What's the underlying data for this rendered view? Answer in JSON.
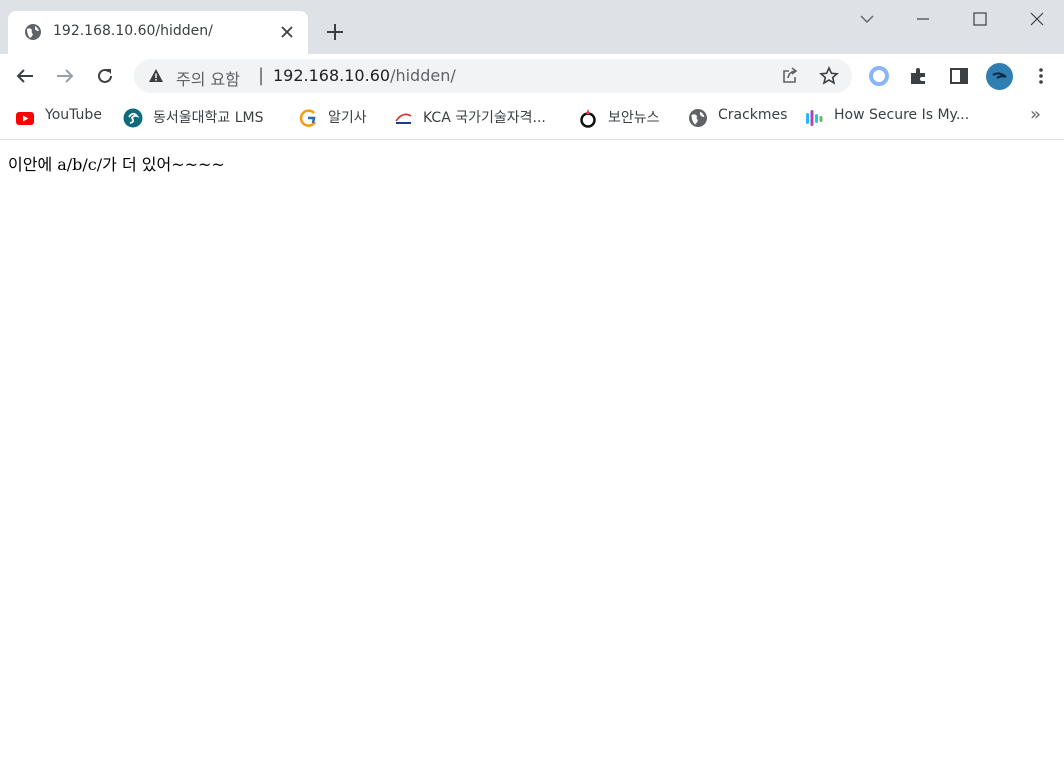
{
  "tab": {
    "title": "192.168.10.60/hidden/"
  },
  "omnibox": {
    "security_text": "주의 요함",
    "separator": "|",
    "url_host": "192.168.10.60",
    "url_path": "/hidden/"
  },
  "bookmarks": [
    {
      "label": "YouTube",
      "icon": "youtube-icon"
    },
    {
      "label": "동서울대학교 LMS",
      "icon": "dsu-icon"
    },
    {
      "label": "알기사",
      "icon": "algisa-icon"
    },
    {
      "label": "KCA 국가기술자격...",
      "icon": "kca-icon"
    },
    {
      "label": "보안뉴스",
      "icon": "boannews-icon"
    },
    {
      "label": "Crackmes",
      "icon": "globe-icon"
    },
    {
      "label": "How Secure Is My...",
      "icon": "hsim-icon"
    }
  ],
  "bookmarks_more": "»",
  "page": {
    "text": "이안에 a/b/c/가 더 있어~~~~"
  },
  "colors": {
    "titlebar": "#dee1e6",
    "omnibox": "#f1f3f4",
    "youtube": "#ff0000"
  }
}
